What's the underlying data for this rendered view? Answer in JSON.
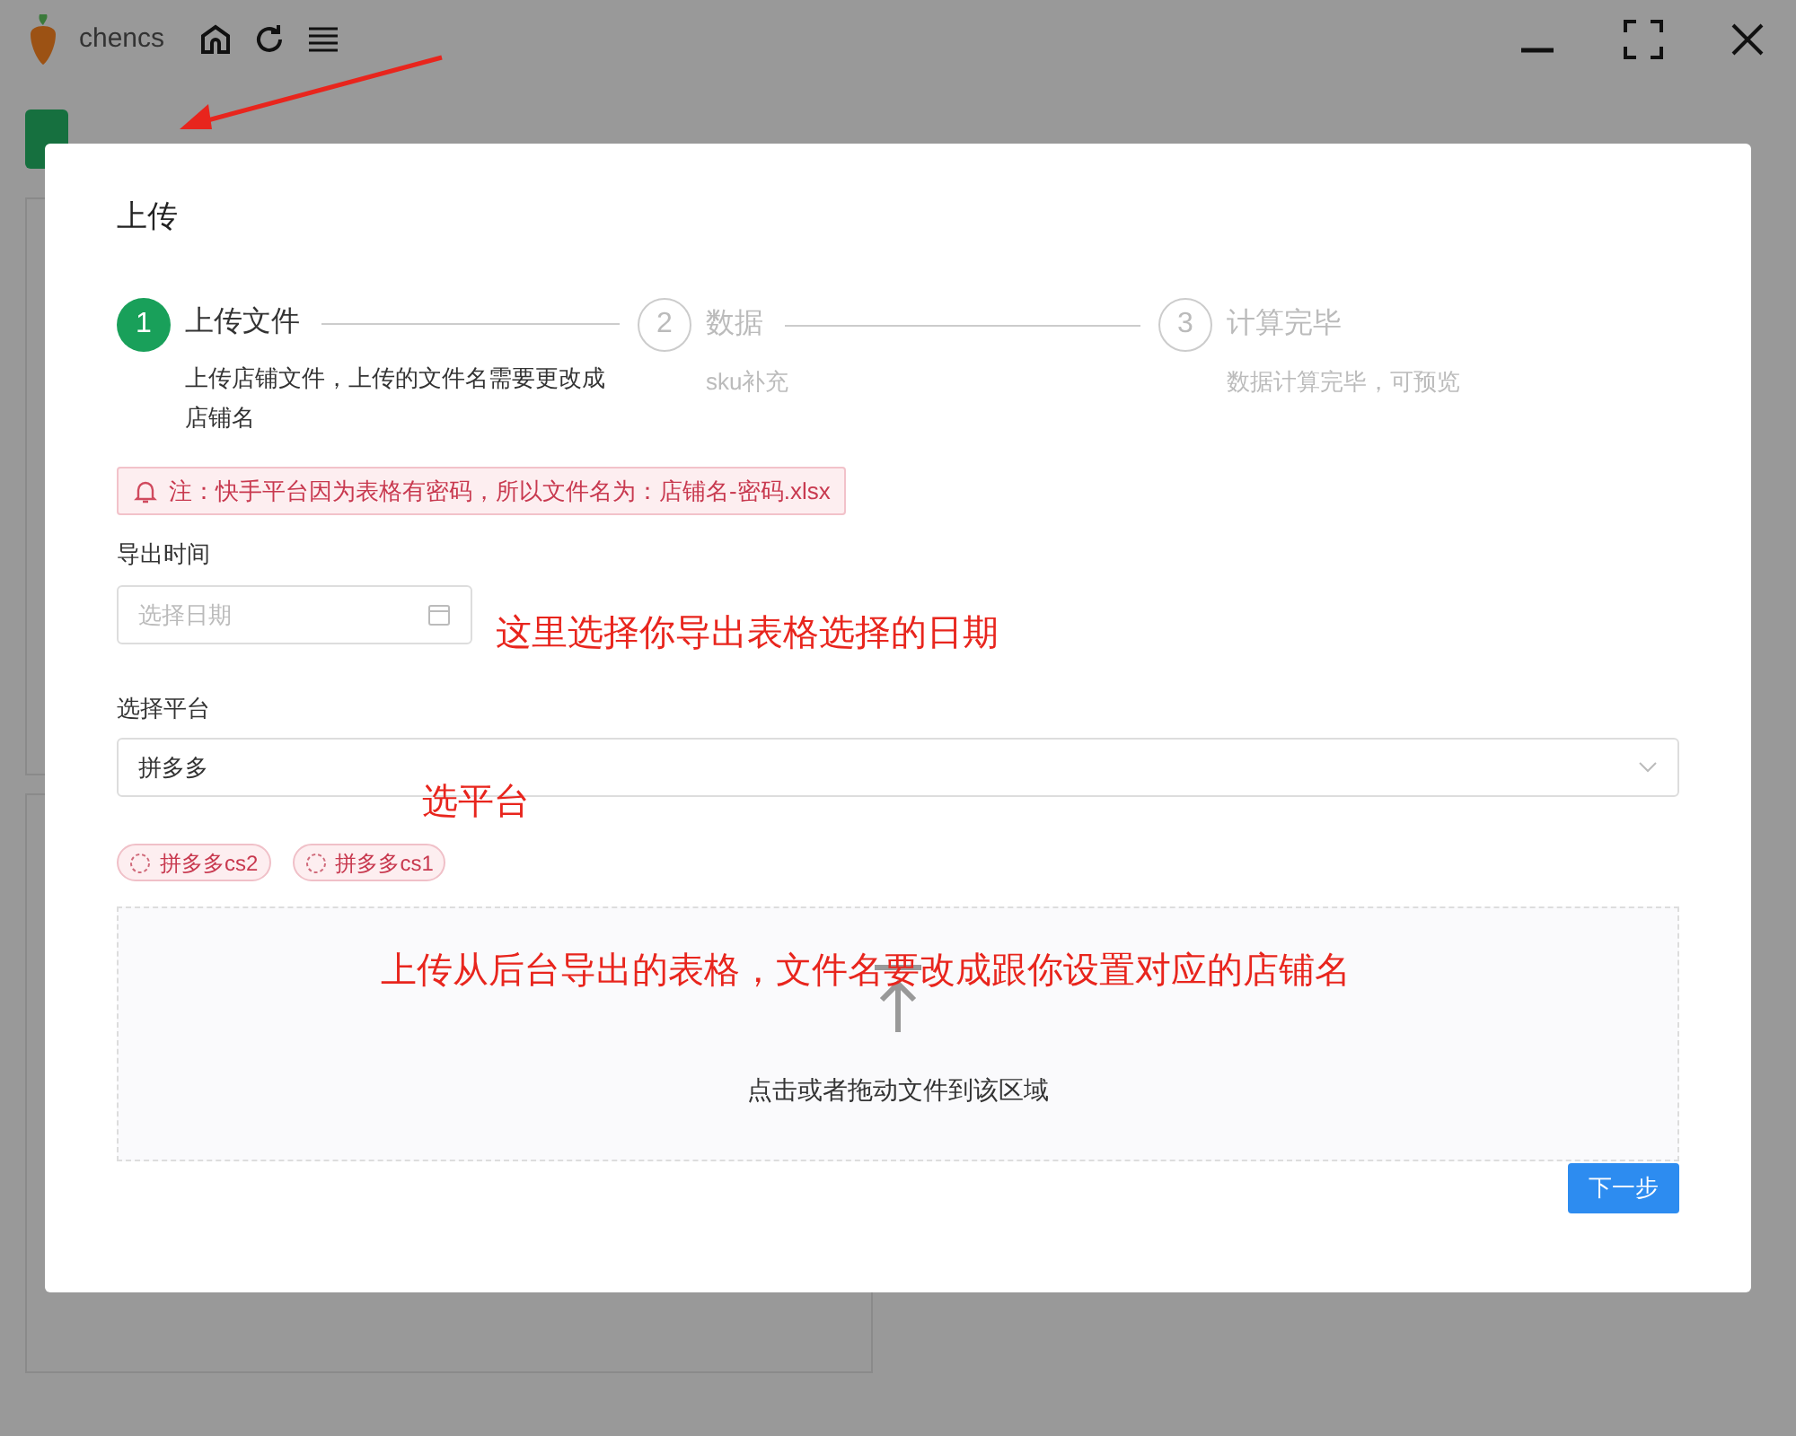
{
  "app": {
    "title": "chencs"
  },
  "dialog": {
    "title": "上传",
    "steps": [
      {
        "number": "1",
        "title": "上传文件",
        "description": "上传店铺文件，上传的文件名需要更改成店铺名",
        "active": true
      },
      {
        "number": "2",
        "title": "数据",
        "description": "sku补充",
        "active": false
      },
      {
        "number": "3",
        "title": "计算完毕",
        "description": "数据计算完毕，可预览",
        "active": false
      }
    ],
    "notice": "注：快手平台因为表格有密码，所以文件名为：店铺名-密码.xlsx",
    "export_time": {
      "label": "导出时间",
      "placeholder": "选择日期"
    },
    "platform": {
      "label": "选择平台",
      "value": "拼多多"
    },
    "tags": [
      {
        "label": "拼多多cs2"
      },
      {
        "label": "拼多多cs1"
      }
    ],
    "upload_area": {
      "hint": "点击或者拖动文件到该区域"
    },
    "next_button": "下一步"
  },
  "annotations": [
    {
      "kind": "date",
      "text": "这里选择你导出表格选择的日期"
    },
    {
      "kind": "platform",
      "text": "选平台"
    },
    {
      "kind": "upload",
      "text": "上传从后台导出的表格，文件名要改成跟你设置对应的店铺名"
    }
  ]
}
